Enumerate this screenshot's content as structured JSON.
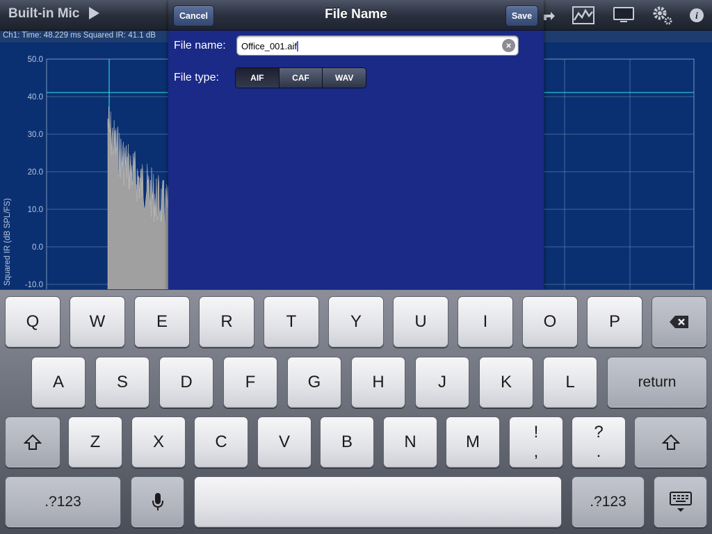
{
  "app": {
    "source_title": "Built-in Mic",
    "info_bar": "Ch1:  Time: 48.229 ms   Squared IR: 41.1 dB",
    "toolbar_icons": [
      "share-icon",
      "chart-icon",
      "display-icon",
      "gears-icon",
      "info-icon"
    ]
  },
  "chart_data": {
    "type": "line",
    "ylabel": "Squared IR (dB SPL/FS)",
    "yticks": [
      "50.0",
      "40.0",
      "30.0",
      "20.0",
      "10.0",
      "0.0",
      "-10.0"
    ],
    "ylim": [
      -10,
      50
    ],
    "grid": true,
    "colors": {
      "background": "#0a3072",
      "grid": "#7c93b8",
      "cursor": "#2fd0d8",
      "trace": "#a0a0a0"
    }
  },
  "modal": {
    "title": "File Name",
    "cancel_label": "Cancel",
    "save_label": "Save",
    "file_name_label": "File name:",
    "file_name_value": "Office_001.aif",
    "file_type_label": "File type:",
    "file_types": [
      "AIF",
      "CAF",
      "WAV"
    ],
    "selected_file_type": "AIF"
  },
  "keyboard": {
    "row1": [
      "Q",
      "W",
      "E",
      "R",
      "T",
      "Y",
      "U",
      "I",
      "O",
      "P"
    ],
    "row2": [
      "A",
      "S",
      "D",
      "F",
      "G",
      "H",
      "J",
      "K",
      "L"
    ],
    "row3": [
      "Z",
      "X",
      "C",
      "V",
      "B",
      "N",
      "M"
    ],
    "return_label": "return",
    "numbers_label": ".?123",
    "punct1_top": "!",
    "punct1_bottom": ",",
    "punct2_top": "?",
    "punct2_bottom": "."
  }
}
